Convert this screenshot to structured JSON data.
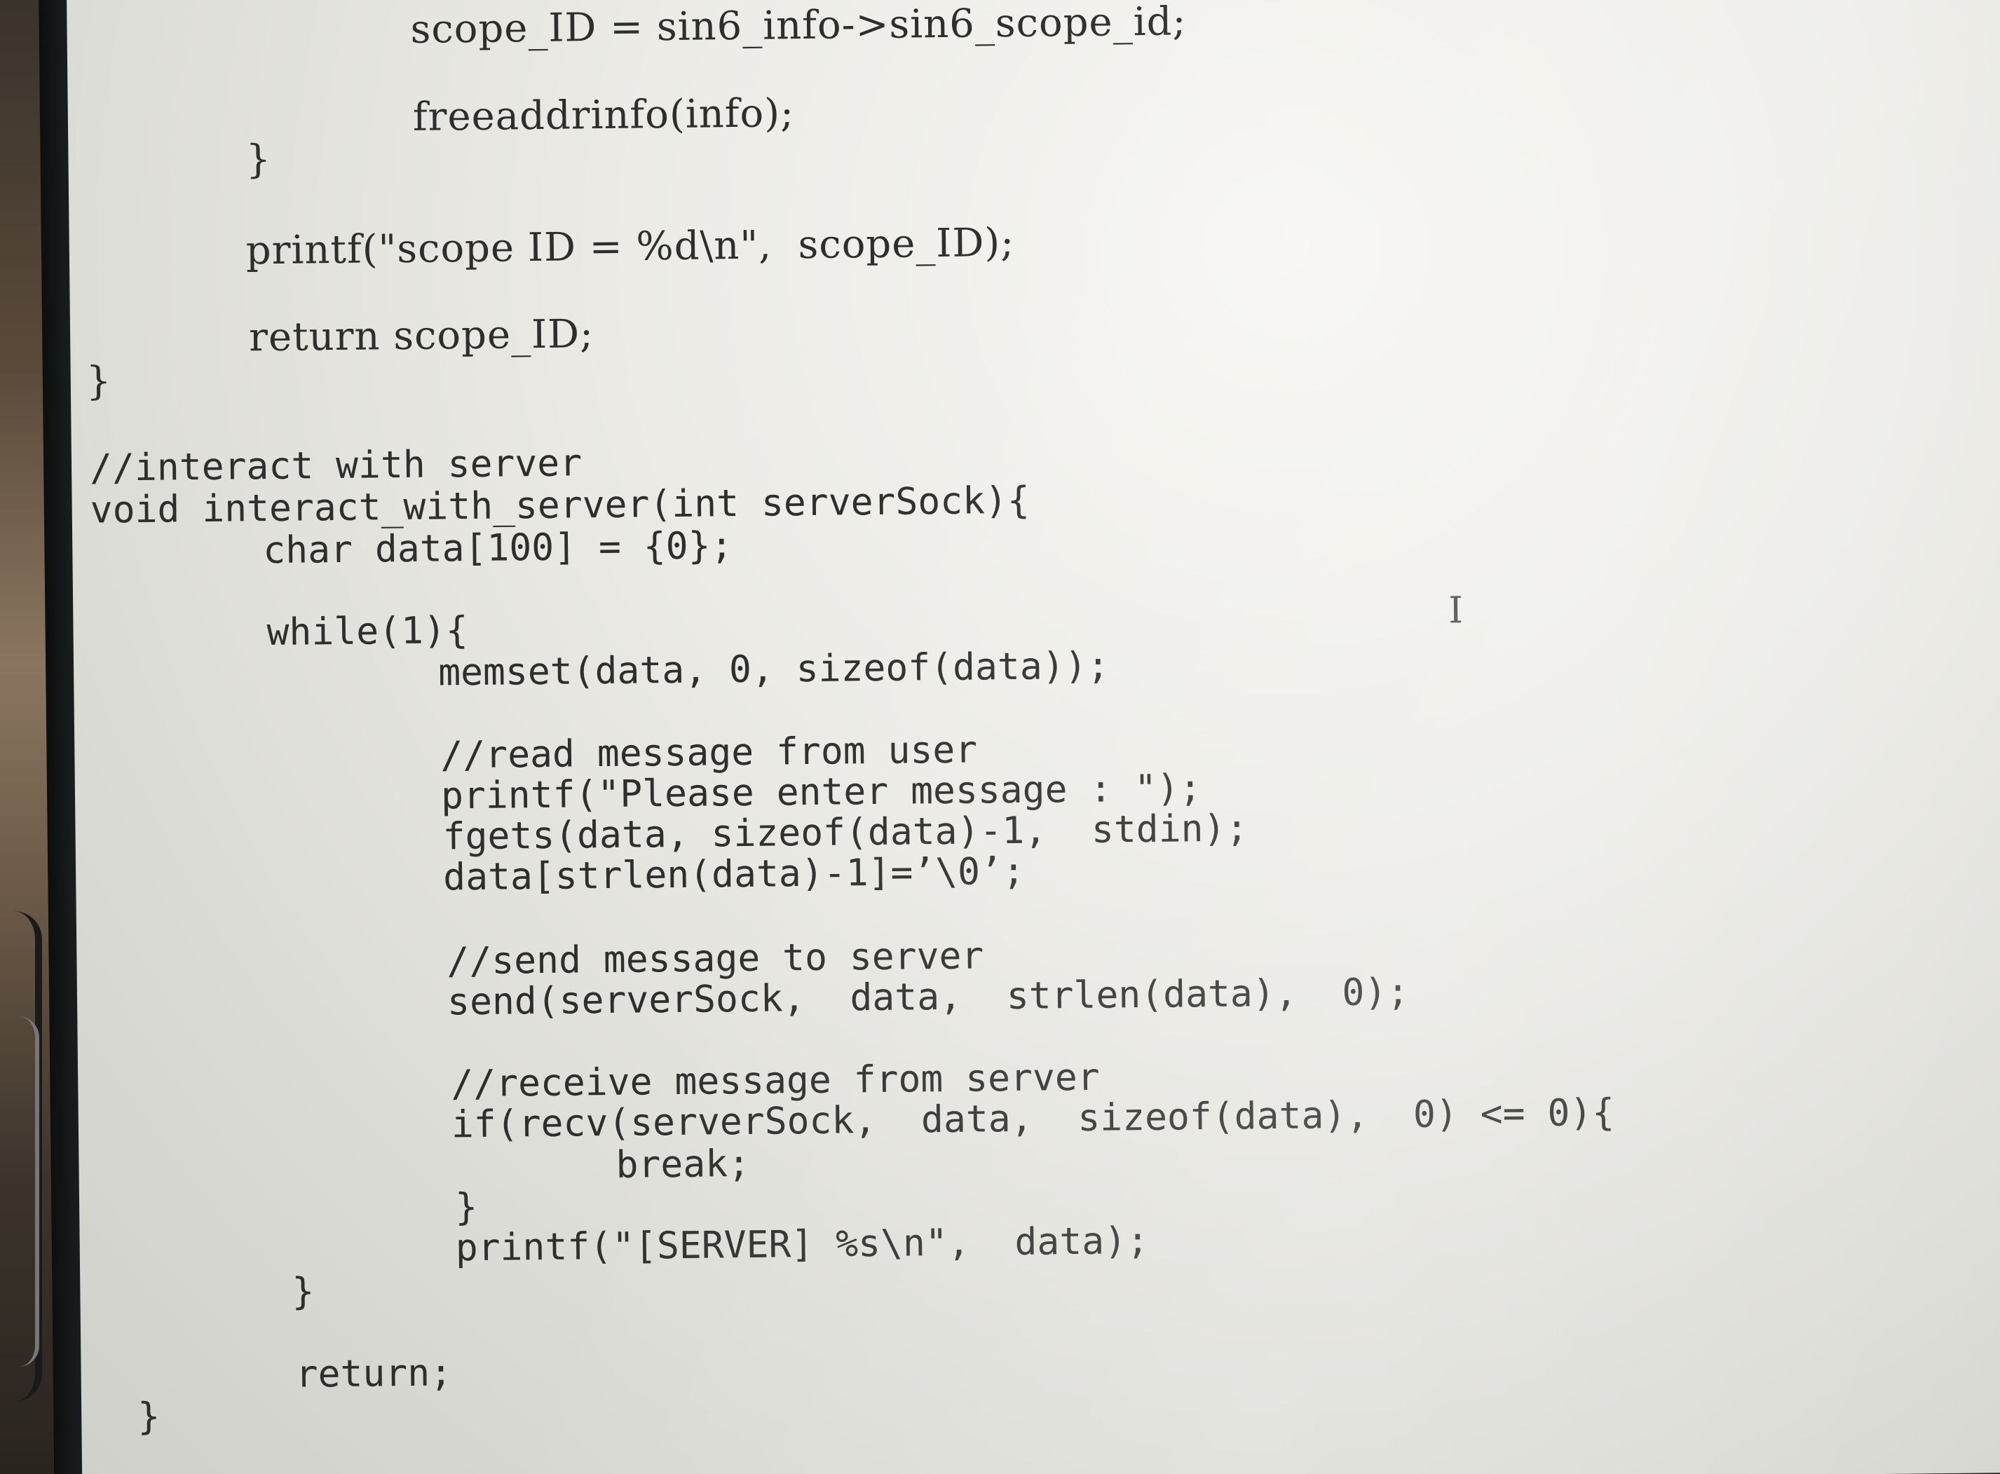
{
  "code": {
    "lines": [
      "scope_ID = sin6_info->sin6_scope_id;",
      "freeaddrinfo(info);",
      "}",
      "printf(\"scope ID = %d\\n\",  scope_ID);",
      "return scope_ID;",
      "}",
      "//interact with server",
      "void interact_with_server(int serverSock){",
      "char data[100] = {0};",
      "while(1){",
      "memset(data, 0, sizeof(data));",
      "//read message from user",
      "printf(\"Please enter message : \");",
      "fgets(data, sizeof(data)-1,  stdin);",
      "data[strlen(data)-1]=’\\0’;",
      "//send message to server",
      "send(serverSock,  data,  strlen(data),  0);",
      "//receive message from server",
      "if(recv(serverSock,  data,  sizeof(data),  0) <= 0){",
      "break;",
      "}",
      "printf(\"[SERVER] %s\\n\",  data);",
      "}",
      "return;",
      "}"
    ],
    "cursor_glyph": "I"
  }
}
